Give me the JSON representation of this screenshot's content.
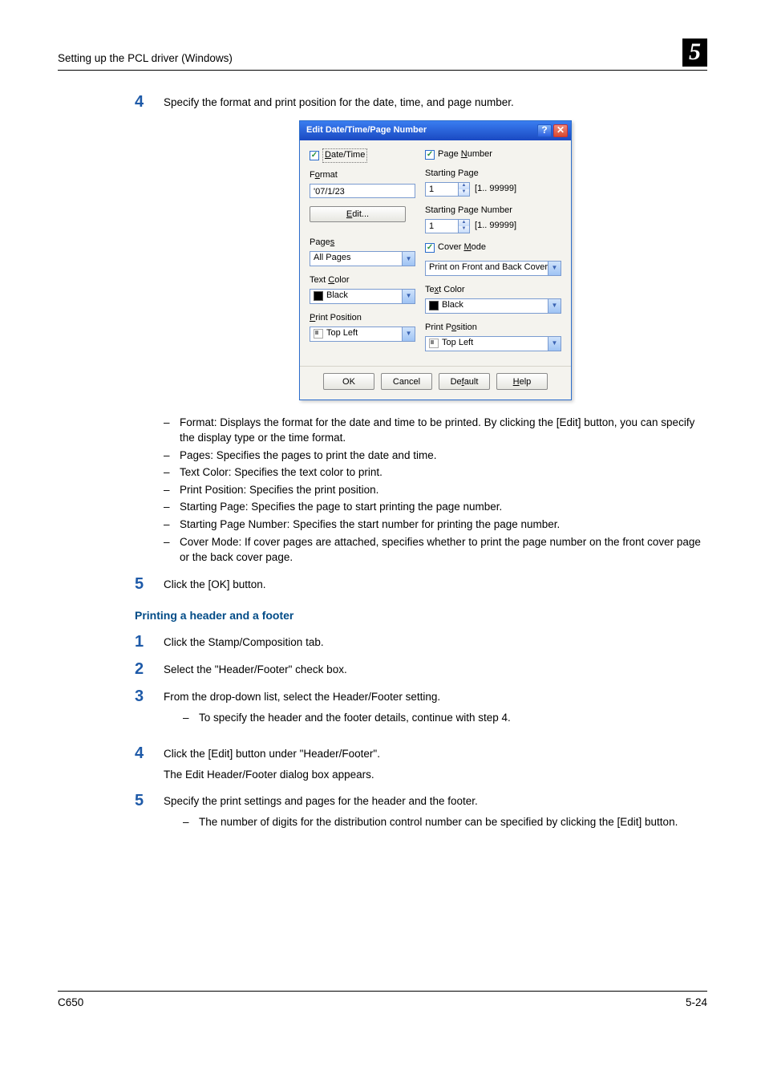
{
  "header": {
    "title": "Setting up the PCL driver (Windows)",
    "chapter": "5"
  },
  "step4": {
    "num": "4",
    "text": "Specify the format and print position for the date, time, and page number.",
    "bullets": [
      "Format: Displays the format for the date and time to be printed. By clicking the [Edit] button, you can specify the display type or the time format.",
      "Pages: Specifies the pages to print the date and time.",
      "Text Color: Specifies the text color to print.",
      "Print Position: Specifies the print position.",
      "Starting Page: Specifies the page to start printing the page number.",
      "Starting Page Number: Specifies the start number for printing the page number.",
      "Cover Mode: If cover pages are attached, specifies whether to print the page number on the front cover page or the back cover page."
    ]
  },
  "step5": {
    "num": "5",
    "text": "Click the [OK] button."
  },
  "subhead2": "Printing a header and a footer",
  "b_step1": {
    "num": "1",
    "text": "Click the Stamp/Composition tab."
  },
  "b_step2": {
    "num": "2",
    "text": "Select the \"Header/Footer\" check box."
  },
  "b_step3": {
    "num": "3",
    "text": "From the drop-down list, select the Header/Footer setting.",
    "bullets": [
      "To specify the header and the footer details, continue with step 4."
    ]
  },
  "b_step4": {
    "num": "4",
    "line1": "Click the [Edit] button under \"Header/Footer\".",
    "line2": "The Edit Header/Footer dialog box appears."
  },
  "b_step5": {
    "num": "5",
    "text": "Specify the print settings and pages for the header and the footer.",
    "bullets": [
      "The number of digits for the distribution control number can be specified by clicking the [Edit] button."
    ]
  },
  "dialog": {
    "title": "Edit Date/Time/Page Number",
    "help_icon": "?",
    "close_icon": "✕",
    "left": {
      "chk_label": "Date/Time",
      "format_lbl": "Format",
      "format_val": "'07/1/23",
      "edit_btn": "Edit...",
      "pages_lbl": "Pages",
      "pages_val": "All Pages",
      "tcolor_lbl": "Text Color",
      "tcolor_val": "Black",
      "ppos_lbl": "Print Position",
      "ppos_val": "Top Left"
    },
    "right": {
      "chk_label": "Page Number",
      "start_page_lbl": "Starting Page",
      "start_page_val": "1",
      "range1": "[1.. 99999]",
      "start_num_lbl": "Starting Page Number",
      "start_num_val": "1",
      "range2": "[1.. 99999]",
      "cover_chk": "Cover Mode",
      "cover_val": "Print on Front and Back Cover",
      "tcolor_lbl": "Text Color",
      "tcolor_val": "Black",
      "ppos_lbl": "Print Position",
      "ppos_val": "Top Left"
    },
    "buttons": {
      "ok": "OK",
      "cancel": "Cancel",
      "default": "Default",
      "help": "Help"
    }
  },
  "footer": {
    "left": "C650",
    "right": "5-24"
  }
}
